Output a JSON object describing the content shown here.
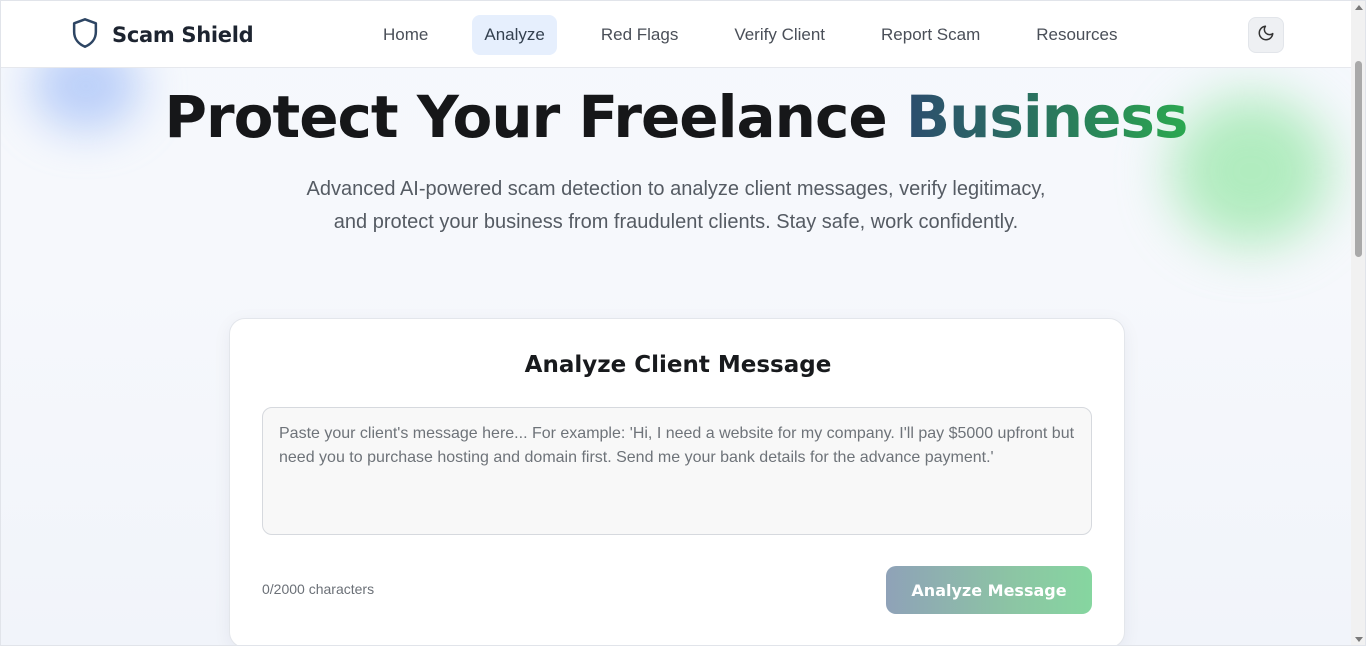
{
  "brand": {
    "name": "Scam Shield",
    "icon": "shield-icon"
  },
  "nav": {
    "items": [
      {
        "label": "Home"
      },
      {
        "label": "Analyze",
        "active": true
      },
      {
        "label": "Red Flags"
      },
      {
        "label": "Verify Client"
      },
      {
        "label": "Report Scam"
      },
      {
        "label": "Resources"
      }
    ],
    "theme_toggle_icon": "moon-icon"
  },
  "hero": {
    "title_main": "Protect Your Freelance ",
    "title_accent": "Business",
    "subtitle": "Advanced AI-powered scam detection to analyze client messages, verify legitimacy, and protect your business from fraudulent clients. Stay safe, work confidently."
  },
  "analyzer": {
    "title": "Analyze Client Message",
    "input_value": "",
    "placeholder": "Paste your client's message here... For example: 'Hi, I need a website for my company. I'll pay $5000 upfront but need you to purchase hosting and domain first. Send me your bank details for the advance payment.'",
    "char_count": "0/2000 characters",
    "button_label": "Analyze Message"
  },
  "colors": {
    "accent_start": "#2c4d6e",
    "accent_end": "#2ba850",
    "nav_active_bg": "#e6effd",
    "button_gradient_start": "#8fa2b8",
    "button_gradient_end": "#86d6a0"
  }
}
